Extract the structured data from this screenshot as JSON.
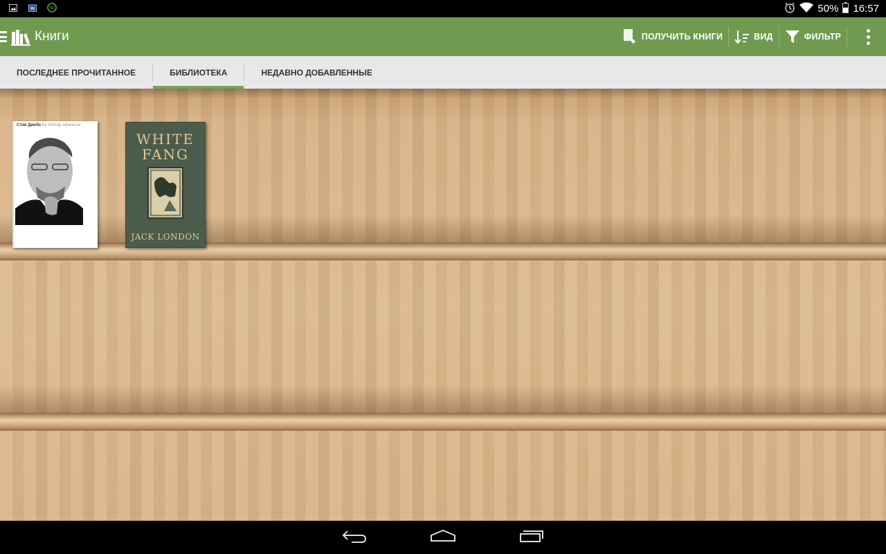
{
  "status_bar": {
    "battery": "50%",
    "time": "16:57",
    "notif_badge": "50",
    "icons": [
      "image-icon",
      "calendar-icon",
      "speed-badge-icon",
      "alarm-icon",
      "wifi-icon",
      "battery-icon"
    ]
  },
  "action_bar": {
    "title": "Книги",
    "get_books_label": "ПОЛУЧИТЬ КНИГИ",
    "view_label": "ВИД",
    "filter_label": "ФИЛЬТР",
    "background": "#6f9a50"
  },
  "tabs": [
    {
      "label": "ПОСЛЕДНЕЕ ПРОЧИТАННОЕ",
      "active": false
    },
    {
      "label": "БИБЛИОТЕКА",
      "active": true
    },
    {
      "label": "НЕДАВНО ДОБАВЛЕННЫЕ",
      "active": false
    }
  ],
  "books": [
    {
      "title": "Стив Джобс",
      "author": "by Уолтер Айзексон"
    },
    {
      "title_line1": "WHITE",
      "title_line2": "FANG",
      "author": "JACK LONDON"
    }
  ],
  "colors": {
    "accent": "#72a652",
    "tabs_bg": "#e8e8e8"
  }
}
